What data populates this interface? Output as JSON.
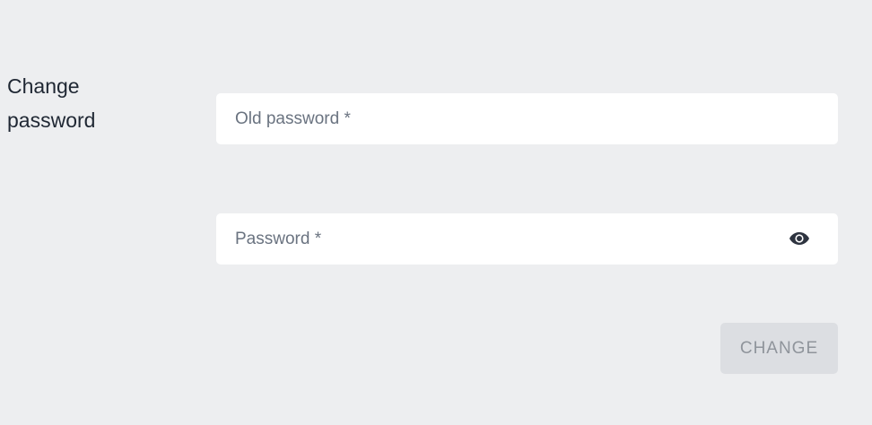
{
  "section": {
    "title_line1": "Change",
    "title_line2": "password"
  },
  "fields": {
    "old_password": {
      "placeholder": "Old password *",
      "value": ""
    },
    "new_password": {
      "placeholder": "Password *",
      "value": "",
      "toggle_icon": "eye-icon"
    }
  },
  "actions": {
    "change_label": "CHANGE",
    "change_disabled": true
  },
  "colors": {
    "background": "#edeef0",
    "field_background": "#ffffff",
    "button_disabled_bg": "#dcdee2",
    "button_disabled_text": "#8f949b",
    "title_text": "#1f2733"
  }
}
